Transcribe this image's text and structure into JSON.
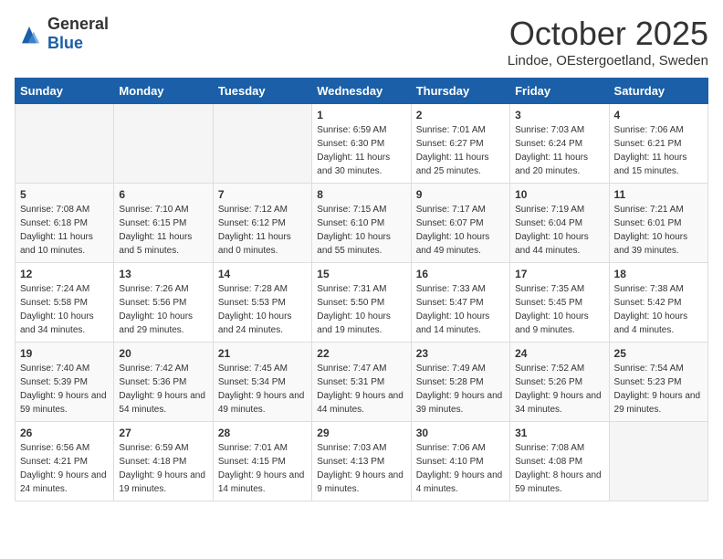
{
  "header": {
    "logo_general": "General",
    "logo_blue": "Blue",
    "month_title": "October 2025",
    "location": "Lindoe, OEstergoetland, Sweden"
  },
  "weekdays": [
    "Sunday",
    "Monday",
    "Tuesday",
    "Wednesday",
    "Thursday",
    "Friday",
    "Saturday"
  ],
  "weeks": [
    [
      {
        "day": "",
        "sunrise": "",
        "sunset": "",
        "daylight": ""
      },
      {
        "day": "",
        "sunrise": "",
        "sunset": "",
        "daylight": ""
      },
      {
        "day": "",
        "sunrise": "",
        "sunset": "",
        "daylight": ""
      },
      {
        "day": "1",
        "sunrise": "Sunrise: 6:59 AM",
        "sunset": "Sunset: 6:30 PM",
        "daylight": "Daylight: 11 hours and 30 minutes."
      },
      {
        "day": "2",
        "sunrise": "Sunrise: 7:01 AM",
        "sunset": "Sunset: 6:27 PM",
        "daylight": "Daylight: 11 hours and 25 minutes."
      },
      {
        "day": "3",
        "sunrise": "Sunrise: 7:03 AM",
        "sunset": "Sunset: 6:24 PM",
        "daylight": "Daylight: 11 hours and 20 minutes."
      },
      {
        "day": "4",
        "sunrise": "Sunrise: 7:06 AM",
        "sunset": "Sunset: 6:21 PM",
        "daylight": "Daylight: 11 hours and 15 minutes."
      }
    ],
    [
      {
        "day": "5",
        "sunrise": "Sunrise: 7:08 AM",
        "sunset": "Sunset: 6:18 PM",
        "daylight": "Daylight: 11 hours and 10 minutes."
      },
      {
        "day": "6",
        "sunrise": "Sunrise: 7:10 AM",
        "sunset": "Sunset: 6:15 PM",
        "daylight": "Daylight: 11 hours and 5 minutes."
      },
      {
        "day": "7",
        "sunrise": "Sunrise: 7:12 AM",
        "sunset": "Sunset: 6:12 PM",
        "daylight": "Daylight: 11 hours and 0 minutes."
      },
      {
        "day": "8",
        "sunrise": "Sunrise: 7:15 AM",
        "sunset": "Sunset: 6:10 PM",
        "daylight": "Daylight: 10 hours and 55 minutes."
      },
      {
        "day": "9",
        "sunrise": "Sunrise: 7:17 AM",
        "sunset": "Sunset: 6:07 PM",
        "daylight": "Daylight: 10 hours and 49 minutes."
      },
      {
        "day": "10",
        "sunrise": "Sunrise: 7:19 AM",
        "sunset": "Sunset: 6:04 PM",
        "daylight": "Daylight: 10 hours and 44 minutes."
      },
      {
        "day": "11",
        "sunrise": "Sunrise: 7:21 AM",
        "sunset": "Sunset: 6:01 PM",
        "daylight": "Daylight: 10 hours and 39 minutes."
      }
    ],
    [
      {
        "day": "12",
        "sunrise": "Sunrise: 7:24 AM",
        "sunset": "Sunset: 5:58 PM",
        "daylight": "Daylight: 10 hours and 34 minutes."
      },
      {
        "day": "13",
        "sunrise": "Sunrise: 7:26 AM",
        "sunset": "Sunset: 5:56 PM",
        "daylight": "Daylight: 10 hours and 29 minutes."
      },
      {
        "day": "14",
        "sunrise": "Sunrise: 7:28 AM",
        "sunset": "Sunset: 5:53 PM",
        "daylight": "Daylight: 10 hours and 24 minutes."
      },
      {
        "day": "15",
        "sunrise": "Sunrise: 7:31 AM",
        "sunset": "Sunset: 5:50 PM",
        "daylight": "Daylight: 10 hours and 19 minutes."
      },
      {
        "day": "16",
        "sunrise": "Sunrise: 7:33 AM",
        "sunset": "Sunset: 5:47 PM",
        "daylight": "Daylight: 10 hours and 14 minutes."
      },
      {
        "day": "17",
        "sunrise": "Sunrise: 7:35 AM",
        "sunset": "Sunset: 5:45 PM",
        "daylight": "Daylight: 10 hours and 9 minutes."
      },
      {
        "day": "18",
        "sunrise": "Sunrise: 7:38 AM",
        "sunset": "Sunset: 5:42 PM",
        "daylight": "Daylight: 10 hours and 4 minutes."
      }
    ],
    [
      {
        "day": "19",
        "sunrise": "Sunrise: 7:40 AM",
        "sunset": "Sunset: 5:39 PM",
        "daylight": "Daylight: 9 hours and 59 minutes."
      },
      {
        "day": "20",
        "sunrise": "Sunrise: 7:42 AM",
        "sunset": "Sunset: 5:36 PM",
        "daylight": "Daylight: 9 hours and 54 minutes."
      },
      {
        "day": "21",
        "sunrise": "Sunrise: 7:45 AM",
        "sunset": "Sunset: 5:34 PM",
        "daylight": "Daylight: 9 hours and 49 minutes."
      },
      {
        "day": "22",
        "sunrise": "Sunrise: 7:47 AM",
        "sunset": "Sunset: 5:31 PM",
        "daylight": "Daylight: 9 hours and 44 minutes."
      },
      {
        "day": "23",
        "sunrise": "Sunrise: 7:49 AM",
        "sunset": "Sunset: 5:28 PM",
        "daylight": "Daylight: 9 hours and 39 minutes."
      },
      {
        "day": "24",
        "sunrise": "Sunrise: 7:52 AM",
        "sunset": "Sunset: 5:26 PM",
        "daylight": "Daylight: 9 hours and 34 minutes."
      },
      {
        "day": "25",
        "sunrise": "Sunrise: 7:54 AM",
        "sunset": "Sunset: 5:23 PM",
        "daylight": "Daylight: 9 hours and 29 minutes."
      }
    ],
    [
      {
        "day": "26",
        "sunrise": "Sunrise: 6:56 AM",
        "sunset": "Sunset: 4:21 PM",
        "daylight": "Daylight: 9 hours and 24 minutes."
      },
      {
        "day": "27",
        "sunrise": "Sunrise: 6:59 AM",
        "sunset": "Sunset: 4:18 PM",
        "daylight": "Daylight: 9 hours and 19 minutes."
      },
      {
        "day": "28",
        "sunrise": "Sunrise: 7:01 AM",
        "sunset": "Sunset: 4:15 PM",
        "daylight": "Daylight: 9 hours and 14 minutes."
      },
      {
        "day": "29",
        "sunrise": "Sunrise: 7:03 AM",
        "sunset": "Sunset: 4:13 PM",
        "daylight": "Daylight: 9 hours and 9 minutes."
      },
      {
        "day": "30",
        "sunrise": "Sunrise: 7:06 AM",
        "sunset": "Sunset: 4:10 PM",
        "daylight": "Daylight: 9 hours and 4 minutes."
      },
      {
        "day": "31",
        "sunrise": "Sunrise: 7:08 AM",
        "sunset": "Sunset: 4:08 PM",
        "daylight": "Daylight: 8 hours and 59 minutes."
      },
      {
        "day": "",
        "sunrise": "",
        "sunset": "",
        "daylight": ""
      }
    ]
  ]
}
